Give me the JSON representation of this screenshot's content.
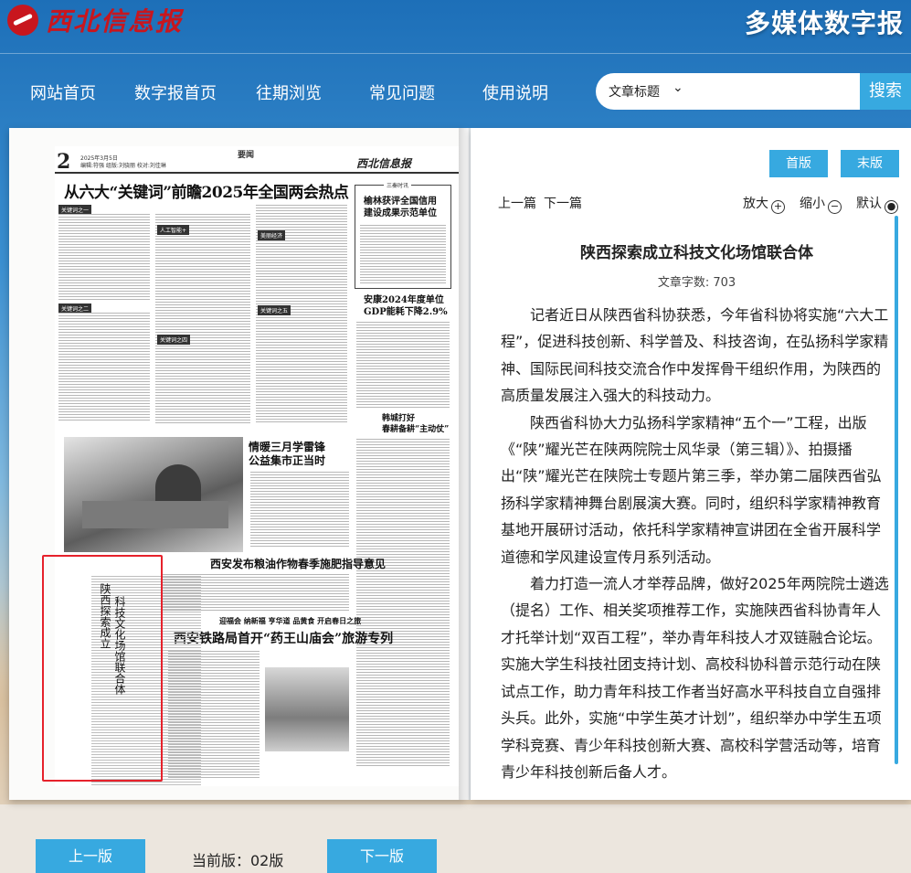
{
  "header": {
    "logo_text": "西北信息报",
    "digital_title": "多媒体数字报"
  },
  "nav": {
    "items": [
      "网站首页",
      "数字报首页",
      "往期浏览",
      "常见问题",
      "使用说明"
    ]
  },
  "search": {
    "select_value": "文章标题",
    "input_value": "",
    "button": "搜索"
  },
  "newspaper": {
    "page_num": "2",
    "date": "2025年3月5日",
    "editor": "编辑:符强  组版:刘骁丽  校对:刘佳琳",
    "section": "要闻",
    "masthead": "西北信息报",
    "headline": "从六大“关键词”前瞻2025年全国两会热点",
    "box_label": "三秦时讯",
    "box_headline_1": "榆林获评全国信用",
    "box_headline_2": "建设成果示范单位",
    "headline_gdp_1": "安康2024年度单位",
    "headline_gdp_2": "GDP能耗下降2.9%",
    "headline_farm_1": "韩城打好",
    "headline_farm_2": "春耕备耕“主动仗”",
    "headline_market_1": "情暖三月学雷锋",
    "headline_market_2": "公益集市正当时",
    "headline_fertilizer": "西安发布粮油作物春季施肥指导意见",
    "pill_row": "迎福会  纳新福  亨华道  品黄食  开启春日之旅",
    "headline_rail": "西安铁路局首开“药王山庙会”旅游专列",
    "tags": [
      "关键词之一",
      "关键词之二",
      "关键词之三",
      "关键词之四",
      "关键词之五",
      "关键词之六",
      "全国人大代表",
      "人工智能+",
      "美丽经济",
      "民生保障",
      "平安建设"
    ],
    "highlight_title_col1": "陕西探索成立",
    "highlight_title_col2": "科技文化场馆联合体"
  },
  "article": {
    "first_edition": "首版",
    "last_edition": "末版",
    "prev_article": "上一篇",
    "next_article": "下一篇",
    "zoom_in": "放大",
    "zoom_out": "缩小",
    "default": "默认",
    "title": "陕西探索成立科技文化场馆联合体",
    "word_count": "文章字数: 703",
    "paragraphs": [
      "记者近日从陕西省科协获悉，今年省科协将实施“六大工程”，促进科技创新、科学普及、科技咨询，在弘扬科学家精神、国际民间科技交流合作中发挥骨干组织作用，为陕西的高质量发展注入强大的科技动力。",
      "陕西省科协大力弘扬科学家精神“五个一”工程，出版《“陕”耀光芒在陕两院院士风华录（第三辑）》、拍摄播出“陕”耀光芒在陕院士专题片第三季，举办第二届陕西省弘扬科学家精神舞台剧展演大赛。同时，组织科学家精神教育基地开展研讨活动，依托科学家精神宣讲团在全省开展科学道德和学风建设宣传月系列活动。",
      "着力打造一流人才举荐品牌，做好2025年两院院士遴选（提名）工作、相关奖项推荐工作，实施陕西省科协青年人才托举计划“双百工程”，举办青年科技人才双链融合论坛。实施大学生科技社团支持计划、高校科协科普示范行动在陕试点工作，助力青年科技工作者当好高水平科技自立自强排头兵。此外，实施“中学生英才计划”，组织举办中学生五项学科竞赛、青少年科技创新大赛、高校科学营活动等，培育青少年科技创新后备人才。"
    ]
  },
  "pager": {
    "prev": "上一版",
    "current": "当前版：02版",
    "next": "下一版"
  },
  "colors": {
    "accent": "#37a9e0",
    "highlight": "#e6212b",
    "brand_red": "#c8161e"
  }
}
